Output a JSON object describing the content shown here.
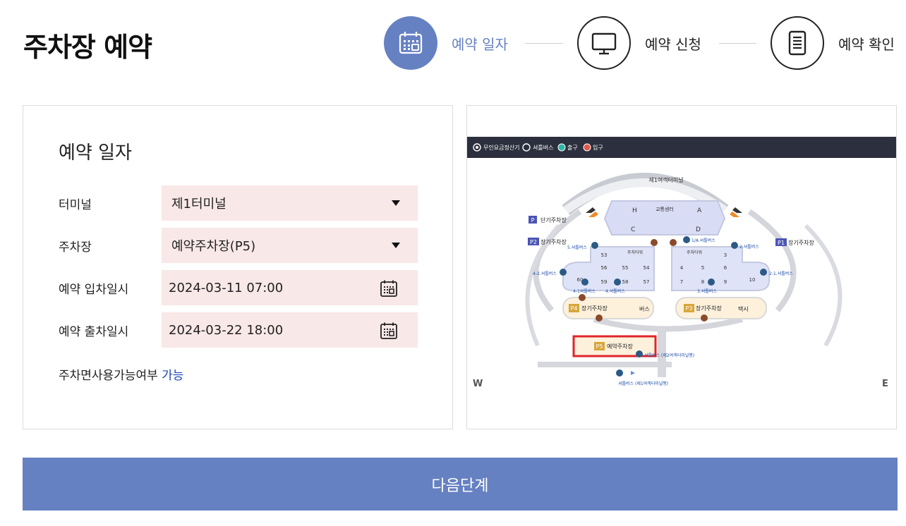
{
  "page": {
    "title": "주차장 예약"
  },
  "steps": [
    {
      "label": "예약 일자",
      "icon": "calendar-icon",
      "active": true
    },
    {
      "label": "예약 신청",
      "icon": "monitor-icon",
      "active": false
    },
    {
      "label": "예약 확인",
      "icon": "document-icon",
      "active": false
    }
  ],
  "form": {
    "heading": "예약 일자",
    "terminal": {
      "label": "터미널",
      "value": "제1터미널"
    },
    "parking": {
      "label": "주차장",
      "value": "예약주차장(P5)"
    },
    "entry": {
      "label": "예약 입차일시",
      "value": "2024-03-11 07:00"
    },
    "exit": {
      "label": "예약 출차일시",
      "value": "2024-03-22 18:00"
    },
    "availability": {
      "label": "주차면사용가능여부",
      "value": "가능"
    }
  },
  "map": {
    "legend": {
      "kiosk": "무인요금정산기",
      "shuttle": "셔틀버스",
      "exit": "출구",
      "entrance": "입구"
    },
    "terminal_name": "제1여객터미널",
    "transport_center": "교통센터",
    "zones": {
      "h": "H",
      "a": "A",
      "c": "C",
      "d": "D"
    },
    "short_term": {
      "badge": "P",
      "label": "단기주차장"
    },
    "p2": {
      "badge": "P2",
      "label": "장기주차장"
    },
    "p1": {
      "badge": "P1",
      "label": "장기주차장"
    },
    "p4": {
      "badge": "P4",
      "label": "장기주차장",
      "extra": "버스"
    },
    "p3": {
      "badge": "P3",
      "label": "장기주차장",
      "extra": "택시"
    },
    "p5": {
      "badge": "P5",
      "label": "예약주차장"
    },
    "tower_label": "주차타워",
    "left_numbers": [
      "53",
      "56",
      "55",
      "54",
      "60",
      "59",
      "58",
      "57"
    ],
    "right_numbers": [
      "3",
      "4",
      "5",
      "6",
      "7",
      "8",
      "9",
      "10"
    ],
    "shuttle_stops": {
      "s5": "5.셔틀버스",
      "s1": "1/A.셔틀버스",
      "s2": "2.셔틀버스",
      "s4_2": "4-2.셔틀버스",
      "s2_1": "2-1.셔틀버스",
      "s4_1": "4-1셔틀버스",
      "s4": "4.셔틀버스",
      "s3": "3.셔틀버스",
      "p5_right": "셔틀버스 (제2여객터미널행)",
      "p5_bottom": "셔틀버스 (제1여객터미널행)"
    },
    "west": "W",
    "east": "E"
  },
  "actions": {
    "next": "다음단계"
  },
  "colors": {
    "accent": "#6681c2",
    "field_bg": "#f9e8e8",
    "available": "#1d45b5",
    "p5_border": "#e0252b"
  }
}
